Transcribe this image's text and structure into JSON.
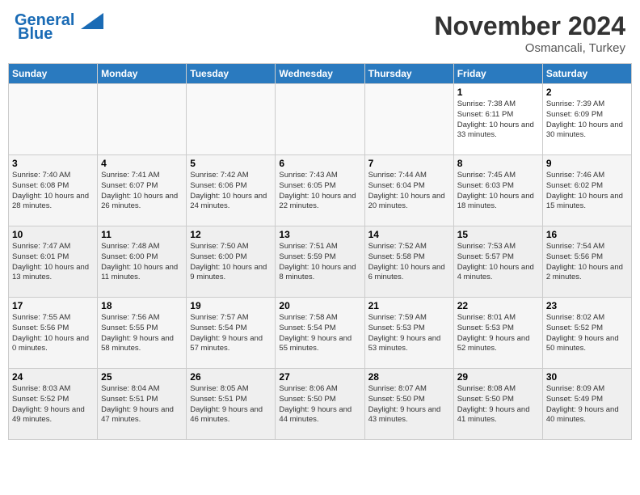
{
  "header": {
    "logo_line1": "General",
    "logo_line2": "Blue",
    "month": "November 2024",
    "location": "Osmancali, Turkey"
  },
  "weekdays": [
    "Sunday",
    "Monday",
    "Tuesday",
    "Wednesday",
    "Thursday",
    "Friday",
    "Saturday"
  ],
  "weeks": [
    [
      {
        "day": "",
        "sunrise": "",
        "sunset": "",
        "daylight": ""
      },
      {
        "day": "",
        "sunrise": "",
        "sunset": "",
        "daylight": ""
      },
      {
        "day": "",
        "sunrise": "",
        "sunset": "",
        "daylight": ""
      },
      {
        "day": "",
        "sunrise": "",
        "sunset": "",
        "daylight": ""
      },
      {
        "day": "",
        "sunrise": "",
        "sunset": "",
        "daylight": ""
      },
      {
        "day": "1",
        "sunrise": "Sunrise: 7:38 AM",
        "sunset": "Sunset: 6:11 PM",
        "daylight": "Daylight: 10 hours and 33 minutes."
      },
      {
        "day": "2",
        "sunrise": "Sunrise: 7:39 AM",
        "sunset": "Sunset: 6:09 PM",
        "daylight": "Daylight: 10 hours and 30 minutes."
      }
    ],
    [
      {
        "day": "3",
        "sunrise": "Sunrise: 7:40 AM",
        "sunset": "Sunset: 6:08 PM",
        "daylight": "Daylight: 10 hours and 28 minutes."
      },
      {
        "day": "4",
        "sunrise": "Sunrise: 7:41 AM",
        "sunset": "Sunset: 6:07 PM",
        "daylight": "Daylight: 10 hours and 26 minutes."
      },
      {
        "day": "5",
        "sunrise": "Sunrise: 7:42 AM",
        "sunset": "Sunset: 6:06 PM",
        "daylight": "Daylight: 10 hours and 24 minutes."
      },
      {
        "day": "6",
        "sunrise": "Sunrise: 7:43 AM",
        "sunset": "Sunset: 6:05 PM",
        "daylight": "Daylight: 10 hours and 22 minutes."
      },
      {
        "day": "7",
        "sunrise": "Sunrise: 7:44 AM",
        "sunset": "Sunset: 6:04 PM",
        "daylight": "Daylight: 10 hours and 20 minutes."
      },
      {
        "day": "8",
        "sunrise": "Sunrise: 7:45 AM",
        "sunset": "Sunset: 6:03 PM",
        "daylight": "Daylight: 10 hours and 18 minutes."
      },
      {
        "day": "9",
        "sunrise": "Sunrise: 7:46 AM",
        "sunset": "Sunset: 6:02 PM",
        "daylight": "Daylight: 10 hours and 15 minutes."
      }
    ],
    [
      {
        "day": "10",
        "sunrise": "Sunrise: 7:47 AM",
        "sunset": "Sunset: 6:01 PM",
        "daylight": "Daylight: 10 hours and 13 minutes."
      },
      {
        "day": "11",
        "sunrise": "Sunrise: 7:48 AM",
        "sunset": "Sunset: 6:00 PM",
        "daylight": "Daylight: 10 hours and 11 minutes."
      },
      {
        "day": "12",
        "sunrise": "Sunrise: 7:50 AM",
        "sunset": "Sunset: 6:00 PM",
        "daylight": "Daylight: 10 hours and 9 minutes."
      },
      {
        "day": "13",
        "sunrise": "Sunrise: 7:51 AM",
        "sunset": "Sunset: 5:59 PM",
        "daylight": "Daylight: 10 hours and 8 minutes."
      },
      {
        "day": "14",
        "sunrise": "Sunrise: 7:52 AM",
        "sunset": "Sunset: 5:58 PM",
        "daylight": "Daylight: 10 hours and 6 minutes."
      },
      {
        "day": "15",
        "sunrise": "Sunrise: 7:53 AM",
        "sunset": "Sunset: 5:57 PM",
        "daylight": "Daylight: 10 hours and 4 minutes."
      },
      {
        "day": "16",
        "sunrise": "Sunrise: 7:54 AM",
        "sunset": "Sunset: 5:56 PM",
        "daylight": "Daylight: 10 hours and 2 minutes."
      }
    ],
    [
      {
        "day": "17",
        "sunrise": "Sunrise: 7:55 AM",
        "sunset": "Sunset: 5:56 PM",
        "daylight": "Daylight: 10 hours and 0 minutes."
      },
      {
        "day": "18",
        "sunrise": "Sunrise: 7:56 AM",
        "sunset": "Sunset: 5:55 PM",
        "daylight": "Daylight: 9 hours and 58 minutes."
      },
      {
        "day": "19",
        "sunrise": "Sunrise: 7:57 AM",
        "sunset": "Sunset: 5:54 PM",
        "daylight": "Daylight: 9 hours and 57 minutes."
      },
      {
        "day": "20",
        "sunrise": "Sunrise: 7:58 AM",
        "sunset": "Sunset: 5:54 PM",
        "daylight": "Daylight: 9 hours and 55 minutes."
      },
      {
        "day": "21",
        "sunrise": "Sunrise: 7:59 AM",
        "sunset": "Sunset: 5:53 PM",
        "daylight": "Daylight: 9 hours and 53 minutes."
      },
      {
        "day": "22",
        "sunrise": "Sunrise: 8:01 AM",
        "sunset": "Sunset: 5:53 PM",
        "daylight": "Daylight: 9 hours and 52 minutes."
      },
      {
        "day": "23",
        "sunrise": "Sunrise: 8:02 AM",
        "sunset": "Sunset: 5:52 PM",
        "daylight": "Daylight: 9 hours and 50 minutes."
      }
    ],
    [
      {
        "day": "24",
        "sunrise": "Sunrise: 8:03 AM",
        "sunset": "Sunset: 5:52 PM",
        "daylight": "Daylight: 9 hours and 49 minutes."
      },
      {
        "day": "25",
        "sunrise": "Sunrise: 8:04 AM",
        "sunset": "Sunset: 5:51 PM",
        "daylight": "Daylight: 9 hours and 47 minutes."
      },
      {
        "day": "26",
        "sunrise": "Sunrise: 8:05 AM",
        "sunset": "Sunset: 5:51 PM",
        "daylight": "Daylight: 9 hours and 46 minutes."
      },
      {
        "day": "27",
        "sunrise": "Sunrise: 8:06 AM",
        "sunset": "Sunset: 5:50 PM",
        "daylight": "Daylight: 9 hours and 44 minutes."
      },
      {
        "day": "28",
        "sunrise": "Sunrise: 8:07 AM",
        "sunset": "Sunset: 5:50 PM",
        "daylight": "Daylight: 9 hours and 43 minutes."
      },
      {
        "day": "29",
        "sunrise": "Sunrise: 8:08 AM",
        "sunset": "Sunset: 5:50 PM",
        "daylight": "Daylight: 9 hours and 41 minutes."
      },
      {
        "day": "30",
        "sunrise": "Sunrise: 8:09 AM",
        "sunset": "Sunset: 5:49 PM",
        "daylight": "Daylight: 9 hours and 40 minutes."
      }
    ]
  ]
}
